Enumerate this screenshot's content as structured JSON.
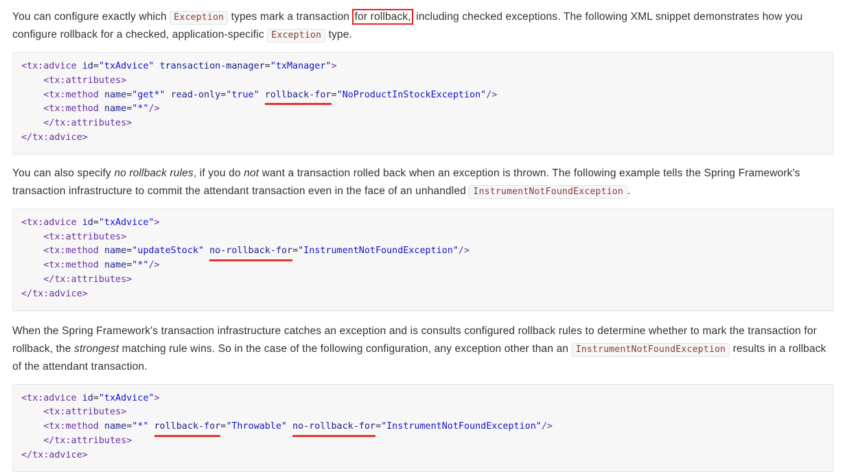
{
  "document": {
    "type": "documentation-page",
    "colors": {
      "annotation_red": "#e8231f",
      "code_bg": "#f7f7f7",
      "code_border": "#e6e6e6",
      "body_text": "#34302d",
      "xml_tag": "#6b2fa0",
      "xml_attr": "#1b1f8a",
      "xml_string": "#1414c8",
      "inline_code_text": "#8b3a3a"
    }
  },
  "paragraph1": {
    "seg1": "You can configure exactly which ",
    "code1": "Exception",
    "seg2": " types mark a transaction ",
    "boxed": "for rollback,",
    "seg3": " including checked exceptions. The following XML snippet demonstrates how you configure rollback for a checked, application-specific ",
    "code2": "Exception",
    "seg4": " type."
  },
  "codeblock1": {
    "lines": [
      {
        "parts": [
          {
            "t": "<tx:advice ",
            "c": "tg"
          },
          {
            "t": "id",
            "c": "at"
          },
          {
            "t": "=",
            "c": "eq"
          },
          {
            "t": "\"txAdvice\"",
            "c": "st"
          },
          {
            "t": " ",
            "c": "eq"
          },
          {
            "t": "transaction-manager",
            "c": "at"
          },
          {
            "t": "=",
            "c": "eq"
          },
          {
            "t": "\"txManager\"",
            "c": "st"
          },
          {
            "t": ">",
            "c": "tg"
          }
        ]
      },
      {
        "parts": [
          {
            "t": "    <tx:attributes>",
            "c": "tg"
          }
        ]
      },
      {
        "parts": [
          {
            "t": "    <tx:method ",
            "c": "tg"
          },
          {
            "t": "name",
            "c": "at"
          },
          {
            "t": "=",
            "c": "eq"
          },
          {
            "t": "\"get*\"",
            "c": "st"
          },
          {
            "t": " ",
            "c": "eq"
          },
          {
            "t": "read-only",
            "c": "at"
          },
          {
            "t": "=",
            "c": "eq"
          },
          {
            "t": "\"true\"",
            "c": "st"
          },
          {
            "t": " ",
            "c": "eq"
          },
          {
            "t": "rollback-for",
            "c": "at",
            "underline": true
          },
          {
            "t": "=",
            "c": "eq"
          },
          {
            "t": "\"NoProductInStockException\"",
            "c": "st"
          },
          {
            "t": "/>",
            "c": "tg"
          }
        ]
      },
      {
        "parts": [
          {
            "t": "    <tx:method ",
            "c": "tg"
          },
          {
            "t": "name",
            "c": "at"
          },
          {
            "t": "=",
            "c": "eq"
          },
          {
            "t": "\"*\"",
            "c": "st"
          },
          {
            "t": "/>",
            "c": "tg"
          }
        ]
      },
      {
        "parts": [
          {
            "t": "    </tx:attributes>",
            "c": "tg"
          }
        ]
      },
      {
        "parts": [
          {
            "t": "</tx:advice>",
            "c": "tg"
          }
        ]
      }
    ]
  },
  "paragraph2": {
    "seg1": "You can also specify ",
    "em1": "no rollback rules",
    "seg2": ", if you do ",
    "em2": "not",
    "seg3": " want a transaction rolled back when an exception is thrown. The following example tells the Spring Framework's transaction infrastructure to commit the attendant transaction even in the face of an unhandled ",
    "code1": "InstrumentNotFoundException",
    "seg4": "."
  },
  "codeblock2": {
    "lines": [
      {
        "parts": [
          {
            "t": "<tx:advice ",
            "c": "tg"
          },
          {
            "t": "id",
            "c": "at"
          },
          {
            "t": "=",
            "c": "eq"
          },
          {
            "t": "\"txAdvice\"",
            "c": "st"
          },
          {
            "t": ">",
            "c": "tg"
          }
        ]
      },
      {
        "parts": [
          {
            "t": "    <tx:attributes>",
            "c": "tg"
          }
        ]
      },
      {
        "parts": [
          {
            "t": "    <tx:method ",
            "c": "tg"
          },
          {
            "t": "name",
            "c": "at"
          },
          {
            "t": "=",
            "c": "eq"
          },
          {
            "t": "\"updateStock\"",
            "c": "st"
          },
          {
            "t": " ",
            "c": "eq"
          },
          {
            "t": "no-rollback-for",
            "c": "at",
            "underline": true
          },
          {
            "t": "=",
            "c": "eq"
          },
          {
            "t": "\"InstrumentNotFoundException\"",
            "c": "st"
          },
          {
            "t": "/>",
            "c": "tg"
          }
        ]
      },
      {
        "parts": [
          {
            "t": "    <tx:method ",
            "c": "tg"
          },
          {
            "t": "name",
            "c": "at"
          },
          {
            "t": "=",
            "c": "eq"
          },
          {
            "t": "\"*\"",
            "c": "st"
          },
          {
            "t": "/>",
            "c": "tg"
          }
        ]
      },
      {
        "parts": [
          {
            "t": "    </tx:attributes>",
            "c": "tg"
          }
        ]
      },
      {
        "parts": [
          {
            "t": "</tx:advice>",
            "c": "tg"
          }
        ]
      }
    ]
  },
  "paragraph3": {
    "seg1": "When the Spring Framework's transaction infrastructure catches an exception and is consults configured rollback rules to determine whether to mark the transaction for rollback, the ",
    "em1": "strongest",
    "seg2": " matching rule wins. So in the case of the following configuration, any exception other than an ",
    "code1": "InstrumentNotFoundException",
    "seg3": " results in a rollback of the attendant transaction."
  },
  "codeblock3": {
    "lines": [
      {
        "parts": [
          {
            "t": "<tx:advice ",
            "c": "tg"
          },
          {
            "t": "id",
            "c": "at"
          },
          {
            "t": "=",
            "c": "eq"
          },
          {
            "t": "\"txAdvice\"",
            "c": "st"
          },
          {
            "t": ">",
            "c": "tg"
          }
        ]
      },
      {
        "parts": [
          {
            "t": "    <tx:attributes>",
            "c": "tg"
          }
        ]
      },
      {
        "parts": [
          {
            "t": "    <tx:method ",
            "c": "tg"
          },
          {
            "t": "name",
            "c": "at"
          },
          {
            "t": "=",
            "c": "eq"
          },
          {
            "t": "\"*\"",
            "c": "st"
          },
          {
            "t": " ",
            "c": "eq"
          },
          {
            "t": "rollback-for",
            "c": "at",
            "underline": true
          },
          {
            "t": "=",
            "c": "eq"
          },
          {
            "t": "\"Throwable\"",
            "c": "st"
          },
          {
            "t": " ",
            "c": "eq"
          },
          {
            "t": "no-rollback-for",
            "c": "at",
            "underline": true
          },
          {
            "t": "=",
            "c": "eq"
          },
          {
            "t": "\"InstrumentNotFoundException\"",
            "c": "st"
          },
          {
            "t": "/>",
            "c": "tg"
          }
        ]
      },
      {
        "parts": [
          {
            "t": "    </tx:attributes>",
            "c": "tg"
          }
        ]
      },
      {
        "parts": [
          {
            "t": "</tx:advice>",
            "c": "tg"
          }
        ]
      }
    ]
  }
}
